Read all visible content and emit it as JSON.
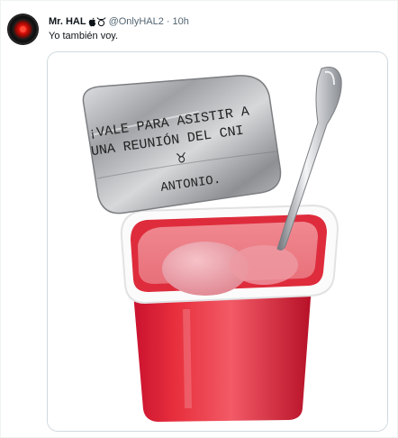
{
  "tweet": {
    "display_name": "Mr. HAL",
    "name_icons": [
      "apple-icon",
      "taurus-icon"
    ],
    "handle": "@OnlyHAL2",
    "separator": "·",
    "time": "10h",
    "text": "Yo también voy."
  },
  "media": {
    "lid_text_line1": "¡VALE PARA ASISTIR A",
    "lid_text_line2": "UNA REUNIÓN DEL CNI",
    "lid_symbol": "♉︎",
    "lid_signature": "ANTONIO."
  },
  "colors": {
    "name": "#0f1419",
    "secondary": "#536471",
    "border": "#cfd9de",
    "yogurt": "#e33a48"
  }
}
